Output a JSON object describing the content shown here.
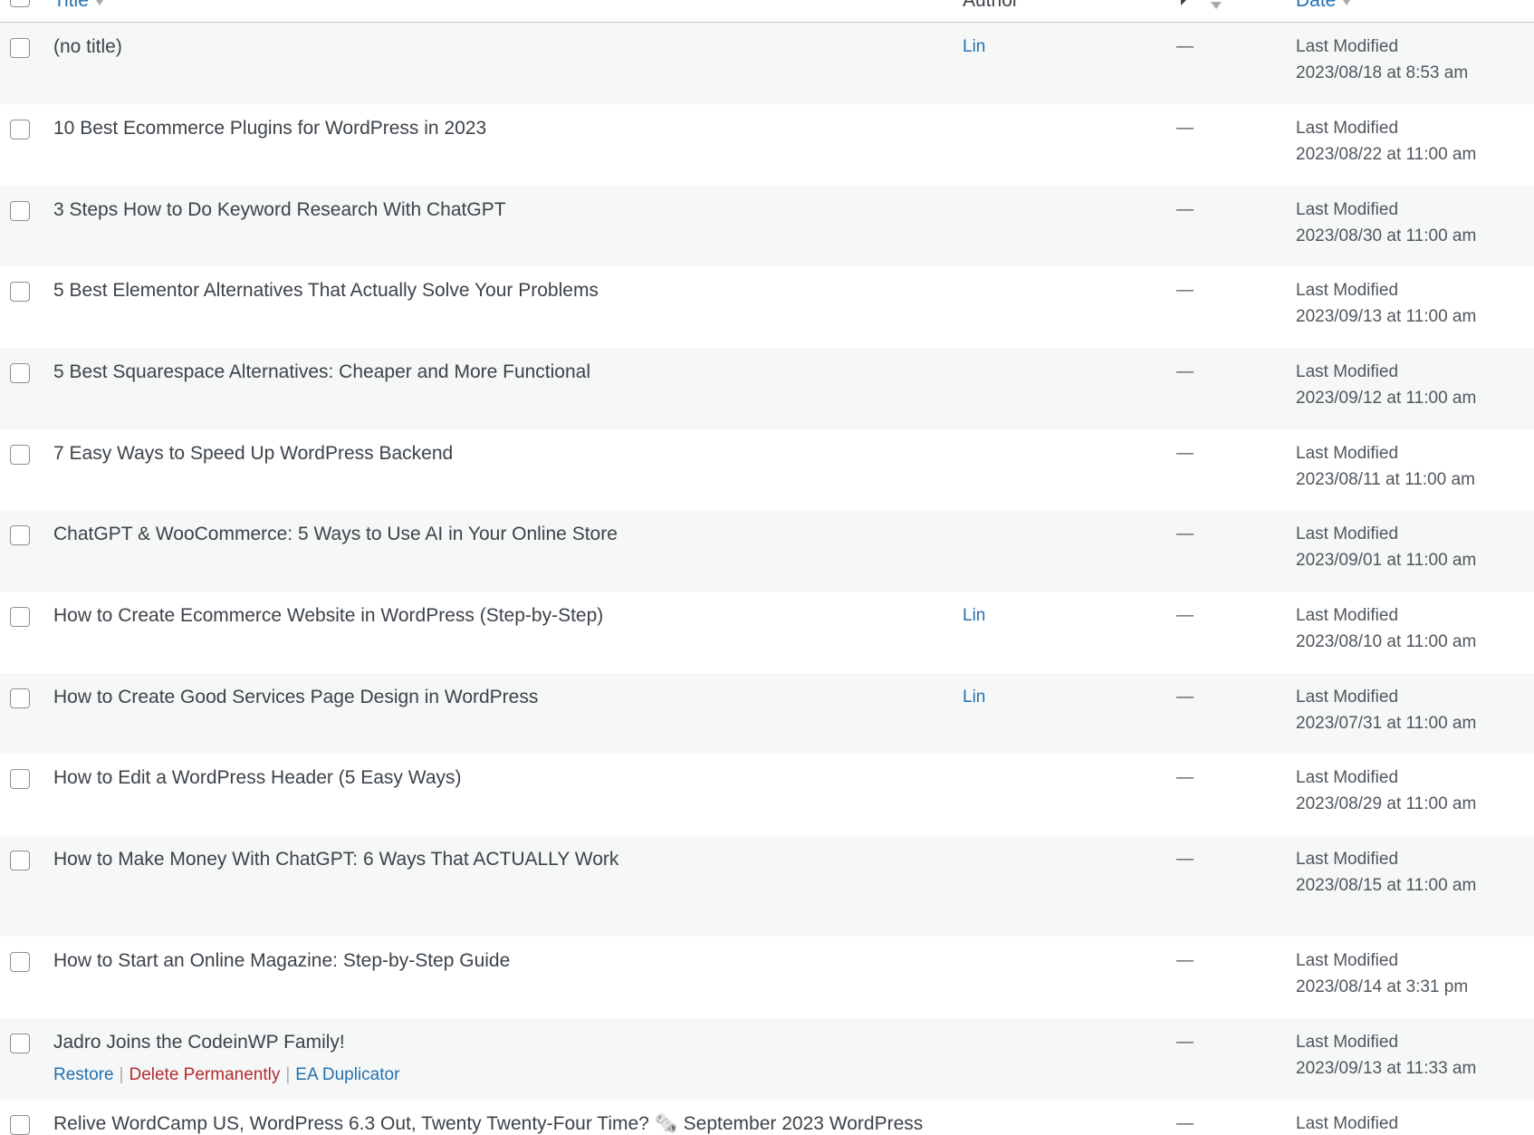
{
  "columns": {
    "title": "Title",
    "author": "Author",
    "date": "Date"
  },
  "colors": {
    "link": "#2271b1",
    "delete": "#b32d2e",
    "alt_row": "#f6f7f7",
    "text": "#3c434a"
  },
  "rows": [
    {
      "title": "(no title)",
      "author": "Lin",
      "comments": "—",
      "date_label": "Last Modified",
      "date_value": "2023/08/18 at 8:53 am"
    },
    {
      "title": "10 Best Ecommerce Plugins for WordPress in 2023",
      "author": "",
      "comments": "—",
      "date_label": "Last Modified",
      "date_value": "2023/08/22 at 11:00 am"
    },
    {
      "title": "3 Steps How to Do Keyword Research With ChatGPT",
      "author": "",
      "comments": "—",
      "date_label": "Last Modified",
      "date_value": "2023/08/30 at 11:00 am"
    },
    {
      "title": "5 Best Elementor Alternatives That Actually Solve Your Problems",
      "author": "",
      "comments": "—",
      "date_label": "Last Modified",
      "date_value": "2023/09/13 at 11:00 am"
    },
    {
      "title": "5 Best Squarespace Alternatives: Cheaper and More Functional",
      "author": "",
      "comments": "—",
      "date_label": "Last Modified",
      "date_value": "2023/09/12 at 11:00 am"
    },
    {
      "title": "7 Easy Ways to Speed Up WordPress Backend",
      "author": "",
      "comments": "—",
      "date_label": "Last Modified",
      "date_value": "2023/08/11 at 11:00 am"
    },
    {
      "title": "ChatGPT & WooCommerce: 5 Ways to Use AI in Your Online Store",
      "author": "",
      "comments": "—",
      "date_label": "Last Modified",
      "date_value": "2023/09/01 at 11:00 am"
    },
    {
      "title": "How to Create Ecommerce Website in WordPress (Step-by-Step)",
      "author": "Lin",
      "comments": "—",
      "date_label": "Last Modified",
      "date_value": "2023/08/10 at 11:00 am"
    },
    {
      "title": "How to Create Good Services Page Design in WordPress",
      "author": "Lin",
      "comments": "—",
      "date_label": "Last Modified",
      "date_value": "2023/07/31 at 11:00 am"
    },
    {
      "title": "How to Edit a WordPress Header (5 Easy Ways)",
      "author": "",
      "comments": "—",
      "date_label": "Last Modified",
      "date_value": "2023/08/29 at 11:00 am"
    },
    {
      "title": "How to Make Money With ChatGPT: 6 Ways That ACTUALLY Work",
      "author": "",
      "comments": "—",
      "date_label": "Last Modified",
      "date_value": "2023/08/15 at 11:00 am"
    },
    {
      "title": "How to Start an Online Magazine: Step-by-Step Guide",
      "author": "",
      "comments": "—",
      "date_label": "Last Modified",
      "date_value": "2023/08/14 at 3:31 pm"
    },
    {
      "title": "Jadro Joins the CodeinWP Family!",
      "author": "",
      "comments": "—",
      "date_label": "Last Modified",
      "date_value": "2023/09/13 at 11:33 am"
    },
    {
      "title": "Relive WordCamp US, WordPress 6.3 Out, Twenty Twenty-Four Time? 🗞️ September 2023 WordPress",
      "author": "",
      "comments": "—",
      "date_label": "Last Modified",
      "date_value": ""
    }
  ],
  "row_actions": {
    "restore": "Restore",
    "delete": "Delete Permanently",
    "duplicate": "EA Duplicator"
  }
}
